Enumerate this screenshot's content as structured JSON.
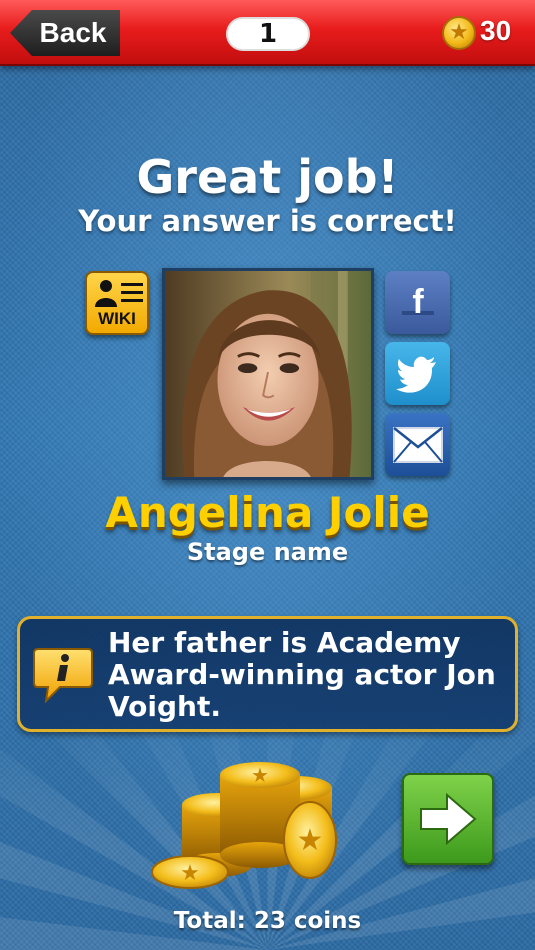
{
  "topbar": {
    "back_label": "Back",
    "level": "1",
    "coins": "30",
    "colors": {
      "bar": "#e81c1c",
      "back": "#1e1e1e"
    }
  },
  "result": {
    "title": "Great job!",
    "subtitle": "Your answer is correct!"
  },
  "wiki": {
    "label": "WIKI",
    "icon": "wiki-contact-card-icon"
  },
  "social": [
    {
      "icon": "facebook-icon",
      "glyph": "f"
    },
    {
      "icon": "twitter-bird-icon"
    },
    {
      "icon": "mail-envelope-icon"
    }
  ],
  "answer": {
    "name": "Angelina Jolie",
    "name_type": "Stage name",
    "name_color": "#ffd000"
  },
  "fact": {
    "icon": "info-bubble-icon",
    "text": "Her father is Academy Award-winning actor Jon Voight."
  },
  "reward": {
    "total_text": "Total: 23 coins",
    "icon": "coin-pile-icon"
  },
  "next": {
    "icon": "arrow-right-icon",
    "color": "#3d9a1c"
  }
}
